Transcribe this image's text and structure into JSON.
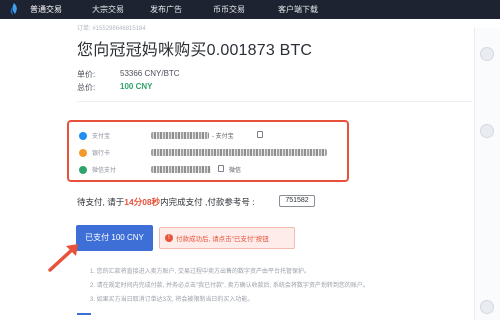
{
  "colors": {
    "topbar": "#1d2330",
    "accent": "#3d6fd6",
    "danger": "#e8523a",
    "success": "#2fa36b"
  },
  "nav": {
    "items": [
      "普通交易",
      "大宗交易",
      "发布广告",
      "币币交易",
      "客户端下载"
    ]
  },
  "order": {
    "id_prefix": "订单:",
    "id": "#155298646815184",
    "title": "您向冠冠妈咪购买0.001873 BTC",
    "price_label": "单价:",
    "price_value": "53366 CNY/BTC",
    "total_label": "总价:",
    "total_value": "100 CNY"
  },
  "payment": {
    "methods": [
      {
        "icon": "alipay-icon",
        "name": "支付宝",
        "sub": "- 支付宝",
        "color": "#1f8ef0"
      },
      {
        "icon": "bank-card-icon",
        "name": "银行卡",
        "sub": "",
        "color": "#f29a2e"
      },
      {
        "icon": "wechat-icon",
        "name": "微信支付",
        "sub": "微信",
        "color": "#2fa36b"
      }
    ]
  },
  "status": {
    "wait_prefix": "待支付,  请于",
    "countdown": "14分08秒",
    "wait_suffix": "内完成支付 ,付款参考号 :",
    "reference": "751582"
  },
  "actions": {
    "paid_button": "已支付 100 CNY",
    "warning_icon": "!",
    "warning": "付款成功后, 请点击\"已支付\"按钮"
  },
  "notes": [
    "1. 您的汇款将直接进入卖方账户, 交易过程中卖方出售的数字资产由平台托管保护。",
    "2. 请在规定时间内完成付款, 并务必点击\"我已付款\", 卖方确认收款后, 系统会将数字资产划转到您的账户。",
    "3. 如果买方当日取消订单达3次, 将会被限制当日的买入功能。"
  ]
}
